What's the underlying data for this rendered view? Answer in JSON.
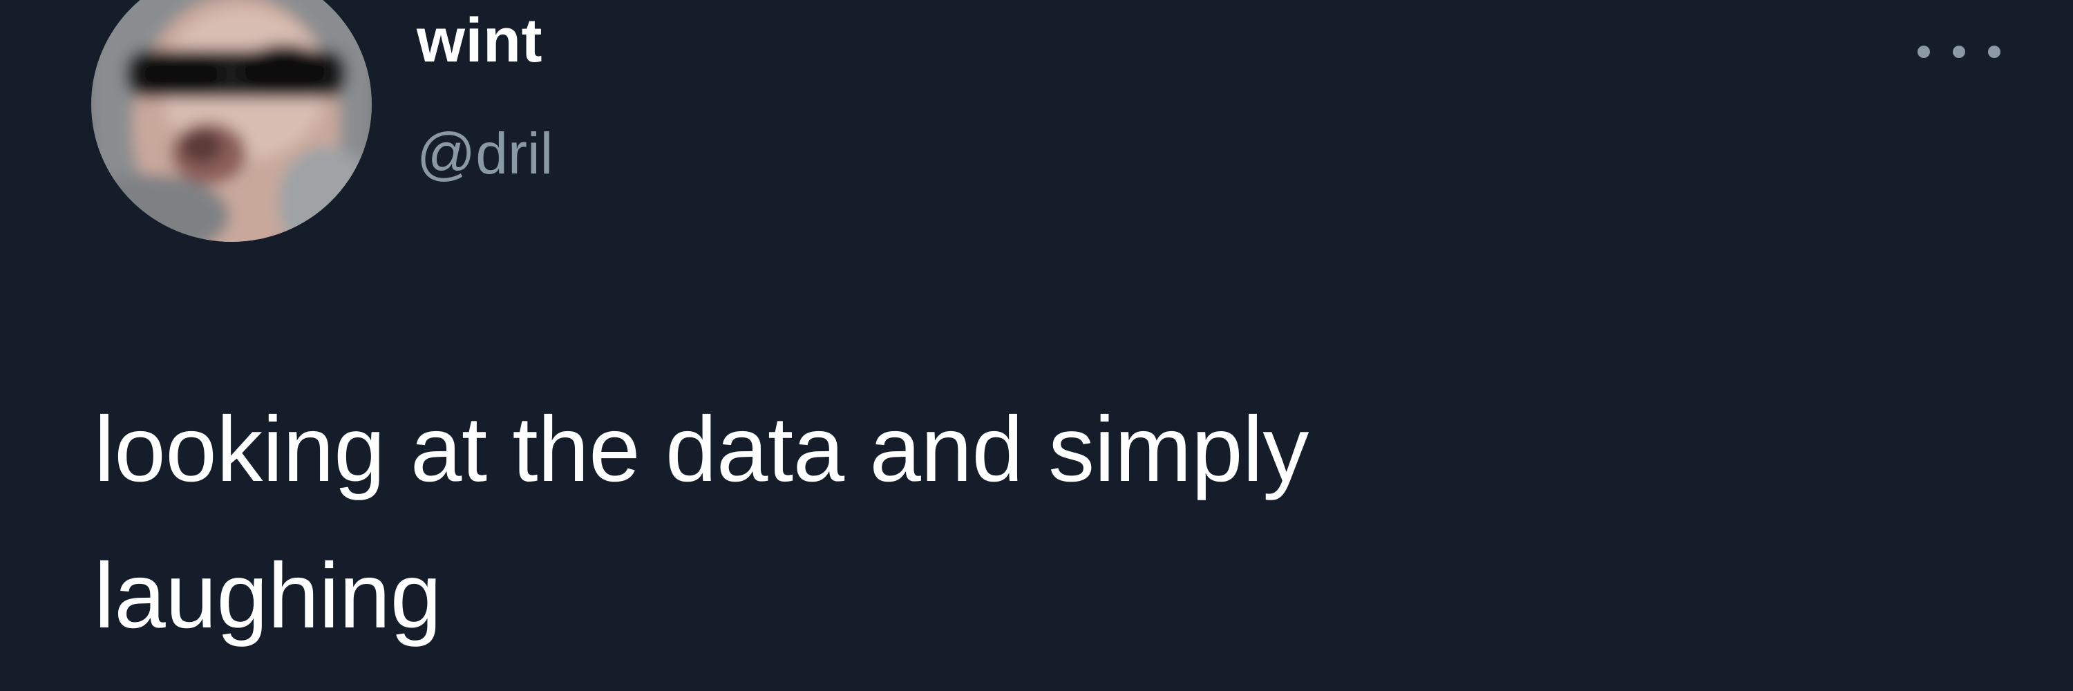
{
  "tweet": {
    "author": {
      "display_name": "wint",
      "handle": "@dril",
      "avatar": "profile-photo-blurry-man-sunglasses"
    },
    "menu_icon": "more-horizontal-icon",
    "text_lines": [
      "looking at the data and simply",
      "laughing"
    ]
  },
  "colors": {
    "background": "#151d2b",
    "primary_text": "#ffffff",
    "secondary_text": "#8b98a5"
  }
}
